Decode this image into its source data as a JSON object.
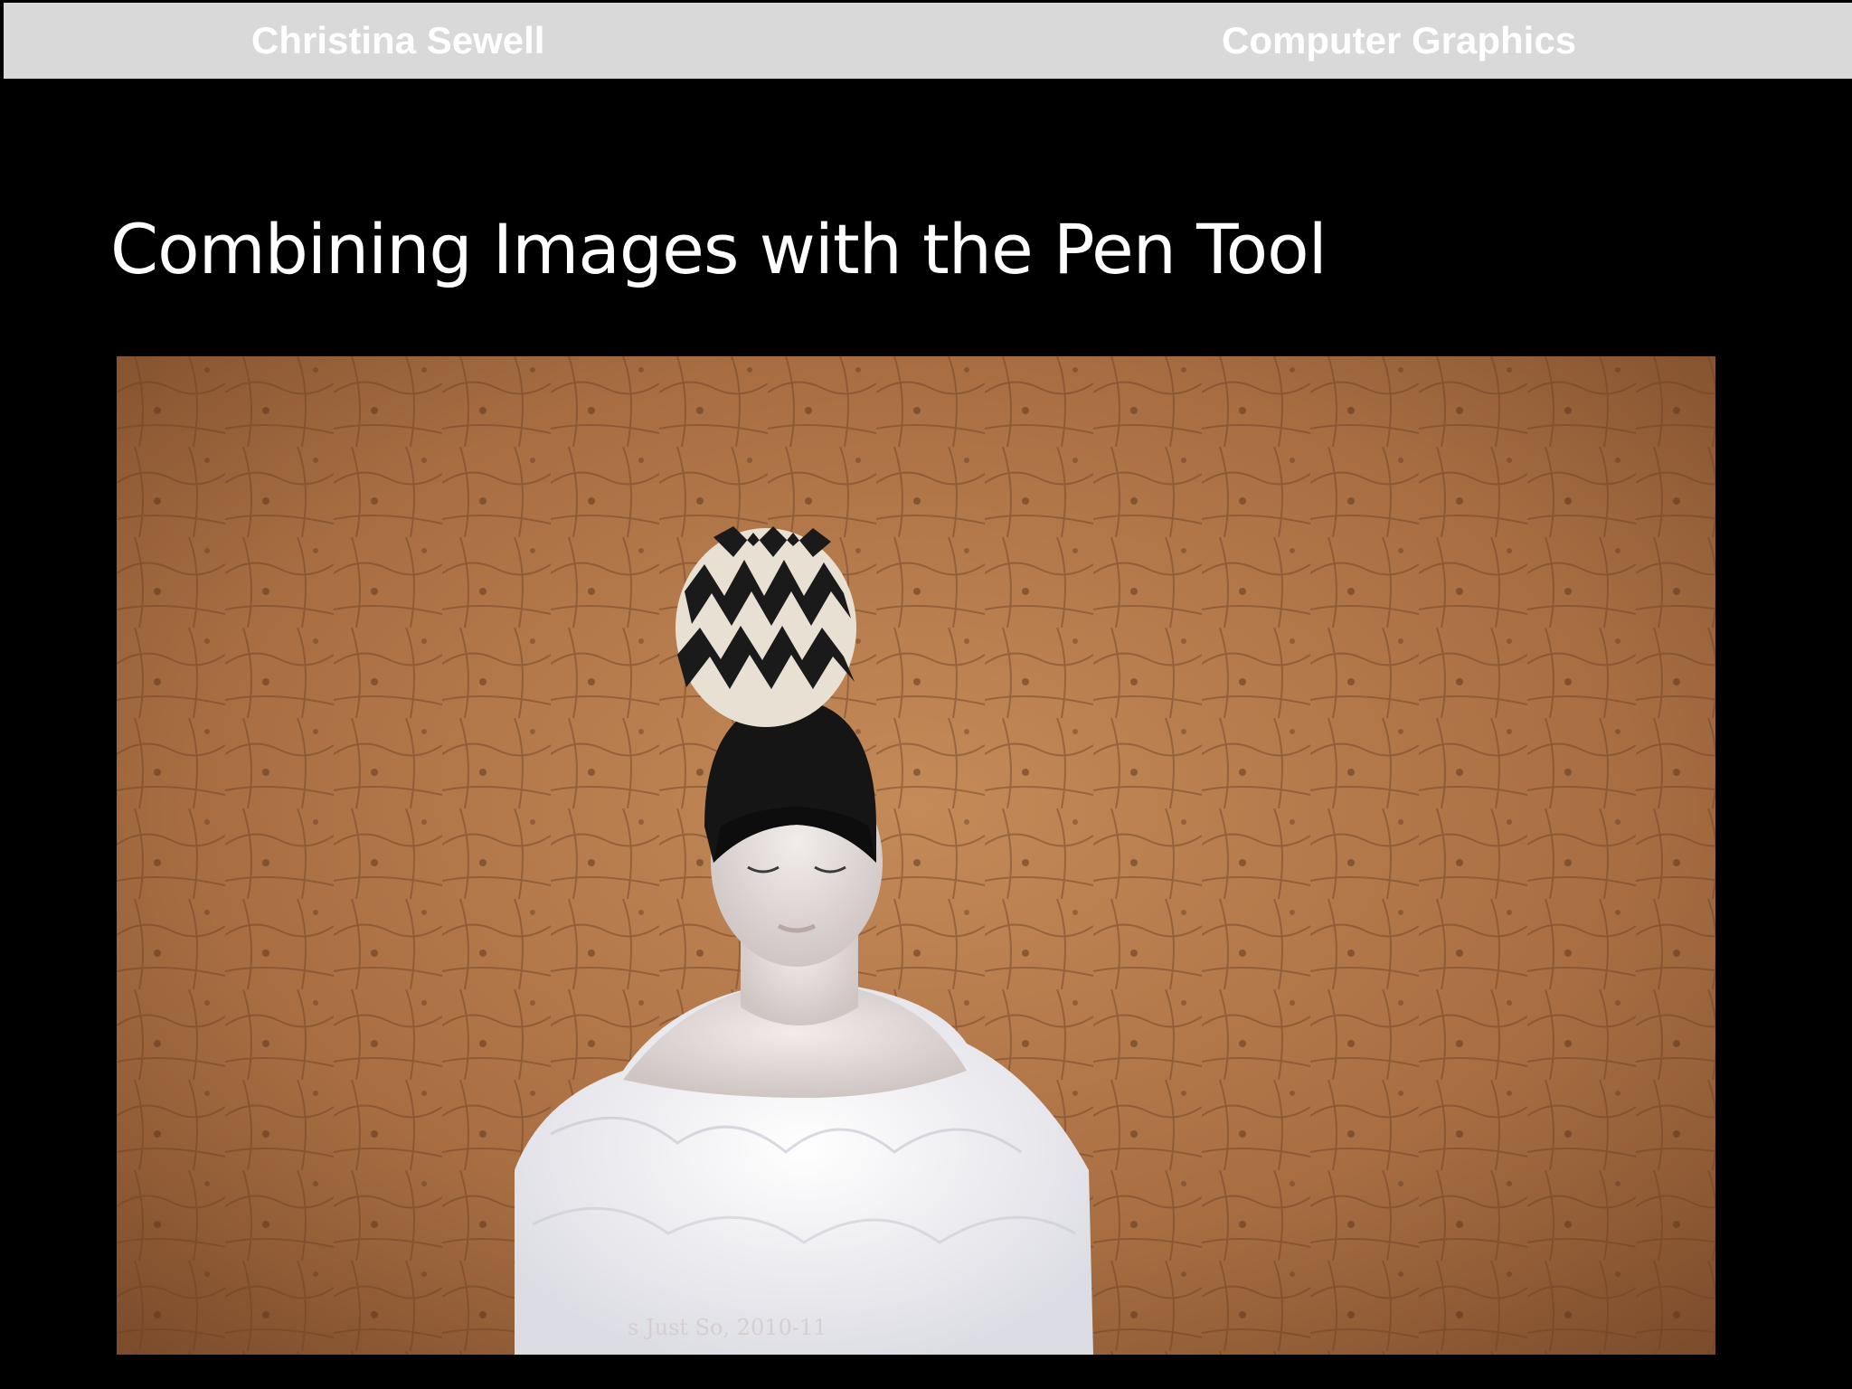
{
  "header": {
    "author": "Christina Sewell",
    "course": "Computer Graphics"
  },
  "slide": {
    "title": "Combining Images with the Pen Tool"
  },
  "photo": {
    "caption": "s Just So, 2010-11",
    "background_color": "#b07a4a",
    "subject_description_icon": "composited-portrait-image"
  },
  "colors": {
    "slide_background": "#000000",
    "header_bar": "#d9d9d9",
    "header_text": "#ffffff",
    "title_text": "#ffffff"
  }
}
